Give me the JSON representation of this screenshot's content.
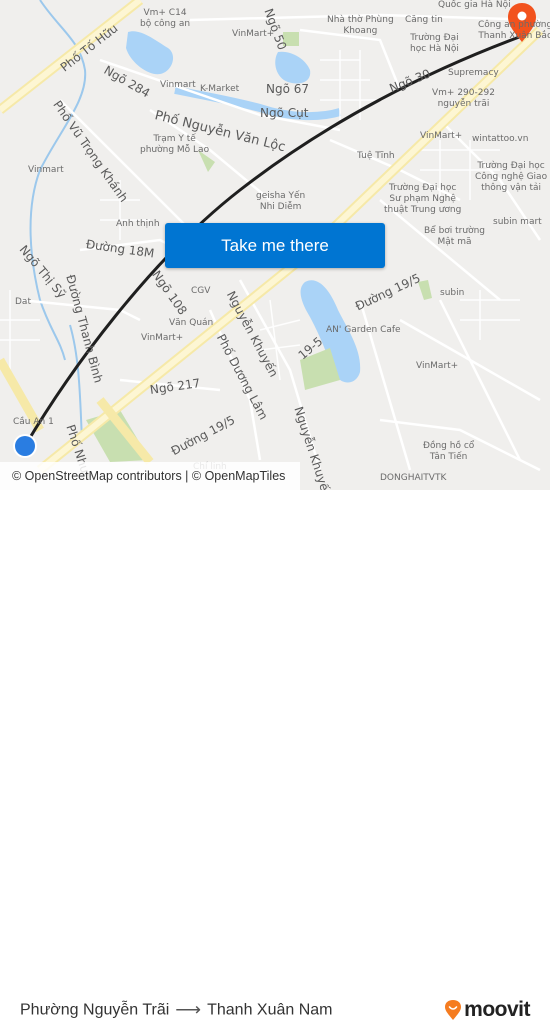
{
  "map": {
    "cta_label": "Take me there",
    "attribution": "© OpenStreetMap contributors | © OpenMapTiles",
    "route_color": "#1f1f1f",
    "origin_color": "#2a7de1",
    "destination_color": "#f2521d",
    "poi_labels": [
      "Vm+ C14\nbộ công an",
      "VinMart+",
      "Nhà thờ Phùng\nKhoang",
      "Căng tin",
      "Trường Đại\nhọc Hà Nội",
      "Quốc gia Hà Nội",
      "Công an phường\nThanh Xuân Bắc",
      "Vinmart",
      "K-Market",
      "Supremacy",
      "Vm+ 290-292\nnguyễn trãi",
      "VinMart+",
      "wintattoo.vn",
      "Trạm Y tế\nphường Mỗ Lao",
      "Tuệ Tĩnh",
      "Trường Đại học\nCông nghệ Giao\nthông vận tải",
      "Vinmart",
      "geisha Yến\nNhi Diễm",
      "Trường Đại học\nSư phạm Nghệ\nthuật Trung ương",
      "Anh thịnh",
      "subin mart",
      "Bể bơi trường\nMật mã",
      "Dat",
      "CGV",
      "Văn Quán",
      "VinMart+",
      "subin",
      "AN' Garden Cafe",
      "VinMart+",
      "Cầu An 1",
      "Đồng hồ cổ\nTân Tiến",
      "DONGHAITVTK",
      "Chí linh"
    ],
    "road_labels": [
      "Phố Tố Hữu",
      "Ngõ 284",
      "Phố Nguyễn Văn Lộc",
      "Ngõ 67",
      "Ngõ Cụt",
      "Ngõ 30",
      "Phố Vũ Trọng Khánh",
      "Đường 18M",
      "Ngõ Thị Sỹ",
      "Đường Thanh Bình",
      "Ngõ 108",
      "Nguyễn Khuyến",
      "Phố Dương Lâm",
      "Đường 19/5",
      "19-5",
      "Ngõ 217",
      "Đường 19/5",
      "Phố Nhuệ",
      "Nguyễn Khuyến",
      "Ngõ 50"
    ]
  },
  "footer": {
    "origin": "Phường Nguyễn Trãi",
    "destination": "Thanh Xuân Nam",
    "arrow": "⟶",
    "brand": "moovit",
    "brand_color": "#f57c20"
  }
}
